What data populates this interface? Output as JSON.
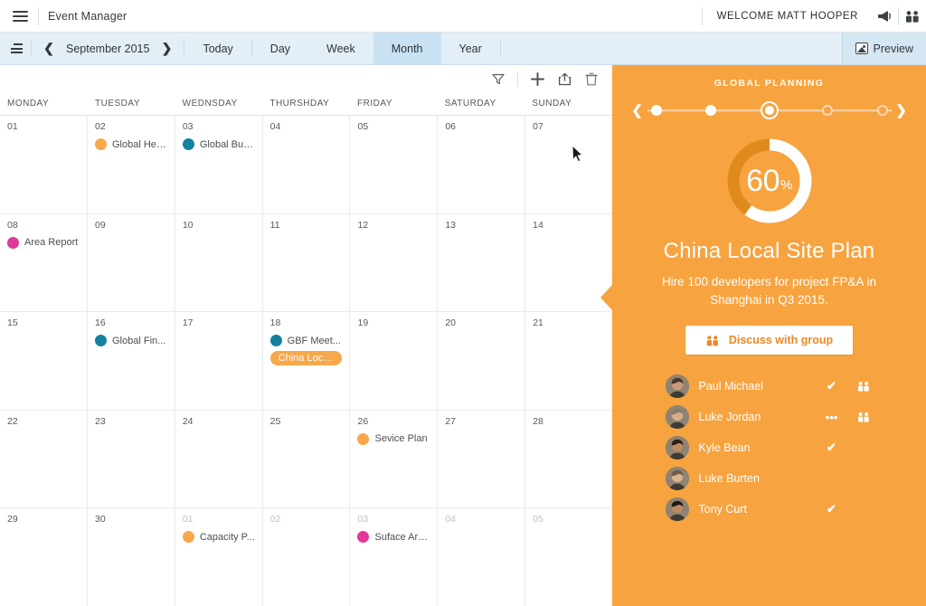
{
  "topbar": {
    "menu_icon": "hamburger-icon",
    "app_title": "Event Manager",
    "welcome": "WELCOME MATT HOOPER",
    "announce_icon": "megaphone-icon",
    "group_icon": "people-group-icon"
  },
  "toolbar": {
    "list_icon": "list-view-icon",
    "prev": "❮",
    "next": "❯",
    "period": "September 2015",
    "views": [
      {
        "label": "Today",
        "active": false
      },
      {
        "label": "Day",
        "active": false
      },
      {
        "label": "Week",
        "active": false
      },
      {
        "label": "Month",
        "active": true
      },
      {
        "label": "Year",
        "active": false
      }
    ],
    "preview_label": "Preview"
  },
  "calendar_actions": [
    {
      "name": "filter-icon"
    },
    {
      "name": "add-icon"
    },
    {
      "name": "share-icon"
    },
    {
      "name": "delete-icon"
    }
  ],
  "calendar": {
    "daynames": [
      "MONDAY",
      "TUESDAY",
      "WEDNSDAY",
      "THURSHDAY",
      "FRIDAY",
      "SATURDAY",
      "SUNDAY"
    ],
    "colors": {
      "orange": "#f7a84b",
      "teal": "#14819f",
      "pink": "#e0389b"
    },
    "weeks": [
      [
        {
          "num": "01",
          "muted": false,
          "events": []
        },
        {
          "num": "02",
          "muted": false,
          "events": [
            {
              "title": "Global Hea...",
              "color": "#f7a84b",
              "selected": false
            }
          ]
        },
        {
          "num": "03",
          "muted": false,
          "events": [
            {
              "title": "Global Bus...",
              "color": "#14819f",
              "selected": false
            }
          ]
        },
        {
          "num": "04",
          "muted": false,
          "events": []
        },
        {
          "num": "05",
          "muted": false,
          "events": []
        },
        {
          "num": "06",
          "muted": false,
          "events": []
        },
        {
          "num": "07",
          "muted": false,
          "events": []
        }
      ],
      [
        {
          "num": "08",
          "muted": false,
          "events": [
            {
              "title": "Area Report",
              "color": "#e0389b",
              "selected": false
            }
          ]
        },
        {
          "num": "09",
          "muted": false,
          "events": []
        },
        {
          "num": "10",
          "muted": false,
          "events": []
        },
        {
          "num": "11",
          "muted": false,
          "events": []
        },
        {
          "num": "12",
          "muted": false,
          "events": []
        },
        {
          "num": "13",
          "muted": false,
          "events": []
        },
        {
          "num": "14",
          "muted": false,
          "events": []
        }
      ],
      [
        {
          "num": "15",
          "muted": false,
          "events": []
        },
        {
          "num": "16",
          "muted": false,
          "events": [
            {
              "title": "Global Fin...",
              "color": "#14819f",
              "selected": false
            }
          ]
        },
        {
          "num": "17",
          "muted": false,
          "events": []
        },
        {
          "num": "18",
          "muted": false,
          "events": [
            {
              "title": "GBF Meet...",
              "color": "#14819f",
              "selected": false
            },
            {
              "title": "China Local Si...",
              "color": "#f7a84b",
              "selected": true
            }
          ]
        },
        {
          "num": "19",
          "muted": false,
          "events": []
        },
        {
          "num": "20",
          "muted": false,
          "events": []
        },
        {
          "num": "21",
          "muted": false,
          "events": []
        }
      ],
      [
        {
          "num": "22",
          "muted": false,
          "events": []
        },
        {
          "num": "23",
          "muted": false,
          "events": []
        },
        {
          "num": "24",
          "muted": false,
          "events": []
        },
        {
          "num": "25",
          "muted": false,
          "events": []
        },
        {
          "num": "26",
          "muted": false,
          "events": [
            {
              "title": "Sevice Plan",
              "color": "#f7a84b",
              "selected": false
            }
          ]
        },
        {
          "num": "27",
          "muted": false,
          "events": []
        },
        {
          "num": "28",
          "muted": false,
          "events": []
        }
      ],
      [
        {
          "num": "29",
          "muted": false,
          "events": []
        },
        {
          "num": "30",
          "muted": false,
          "events": []
        },
        {
          "num": "01",
          "muted": true,
          "events": [
            {
              "title": "Capacity P...",
              "color": "#f7a84b",
              "selected": false
            }
          ]
        },
        {
          "num": "02",
          "muted": true,
          "events": []
        },
        {
          "num": "03",
          "muted": true,
          "events": [
            {
              "title": "Suface Are...",
              "color": "#e0389b",
              "selected": false
            }
          ]
        },
        {
          "num": "04",
          "muted": true,
          "events": []
        },
        {
          "num": "05",
          "muted": true,
          "events": []
        }
      ]
    ]
  },
  "panel": {
    "accent": "#f7a33f",
    "title": "GLOBAL PLANNING",
    "prev_arrow": "❮",
    "next_arrow": "❯",
    "steps": [
      "done",
      "done",
      "active",
      "todo",
      "todo"
    ],
    "progress": {
      "value": 60,
      "unit": "%"
    },
    "plan_title": "China Local Site Plan",
    "plan_desc": "Hire 100 developers for project FP&A in Shanghai in Q3 2015.",
    "discuss_label": "Discuss with group",
    "discuss_icon": "people-group-icon",
    "members": [
      {
        "name": "Paul Michael",
        "status": "✔",
        "group_icon": "people-group-icon",
        "skin": "#c99a7a",
        "hair": "#4a3526"
      },
      {
        "name": "Luke Jordan",
        "status": "•••",
        "group_icon": "people-group-icon",
        "skin": "#d6ae8d",
        "hair": "#8d7a66"
      },
      {
        "name": "Kyle  Bean",
        "status": "✔",
        "group_icon": "",
        "skin": "#c08c63",
        "hair": "#2d2018"
      },
      {
        "name": "Luke Burten",
        "status": "",
        "group_icon": "",
        "skin": "#d8b48f",
        "hair": "#6b5c4a"
      },
      {
        "name": "Tony Curt",
        "status": "✔",
        "group_icon": "",
        "skin": "#bf8a62",
        "hair": "#1f1712"
      }
    ]
  }
}
